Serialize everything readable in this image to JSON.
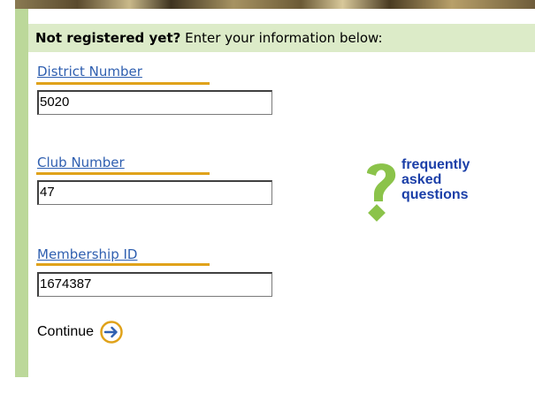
{
  "header": {
    "bold_prompt": "Not registered yet?",
    "prompt": " Enter your information below:"
  },
  "fields": [
    {
      "label": "District Number",
      "value": "5020"
    },
    {
      "label": "Club Number",
      "value": "47"
    },
    {
      "label": "Membership ID",
      "value": "1674387"
    }
  ],
  "faq": {
    "line1": "frequently",
    "line2": "asked",
    "line3": "questions",
    "icon": "question-mark-icon"
  },
  "continue": {
    "label": "Continue",
    "icon": "arrow-right-circle-icon"
  },
  "colors": {
    "accent_green": "#bcd89a",
    "header_bg": "#dcebc8",
    "label_blue": "#2f5fb0",
    "underline_gold": "#e0a21a",
    "faq_blue": "#1b3fa8",
    "question_green": "#8bc34a"
  }
}
